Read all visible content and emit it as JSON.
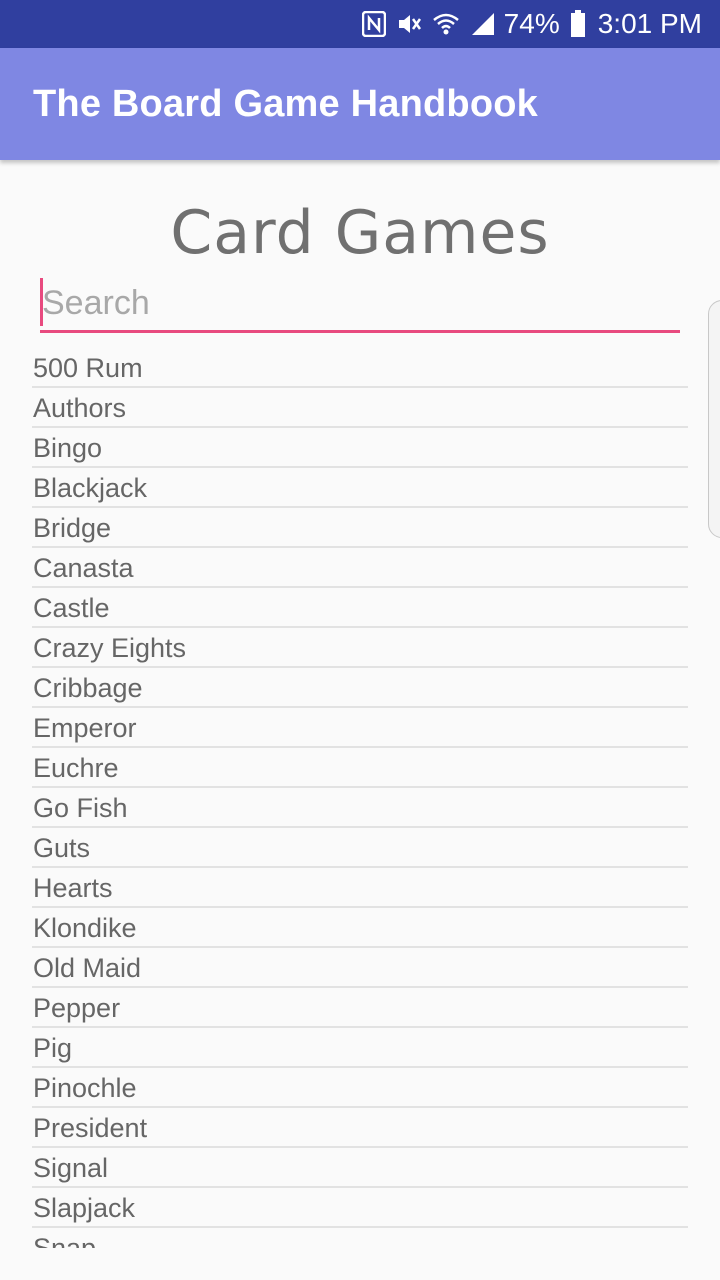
{
  "status_bar": {
    "battery": "74%",
    "time": "3:01 PM",
    "icons": [
      "nfc-icon",
      "mute-icon",
      "wifi-icon",
      "signal-icon",
      "battery-icon"
    ]
  },
  "app_bar": {
    "title": "The Board Game Handbook",
    "color": "#7f87e3"
  },
  "page": {
    "title": "Card Games"
  },
  "search": {
    "placeholder": "Search",
    "value": "",
    "accent": "#e84a7f"
  },
  "games": [
    "500 Rum",
    "Authors",
    "Bingo",
    "Blackjack",
    "Bridge",
    "Canasta",
    "Castle",
    "Crazy Eights",
    "Cribbage",
    "Emperor",
    "Euchre",
    "Go Fish",
    "Guts",
    "Hearts",
    "Klondike",
    "Old Maid",
    "Pepper",
    "Pig",
    "Pinochle",
    "President",
    "Signal",
    "Slapjack",
    "Snap"
  ]
}
